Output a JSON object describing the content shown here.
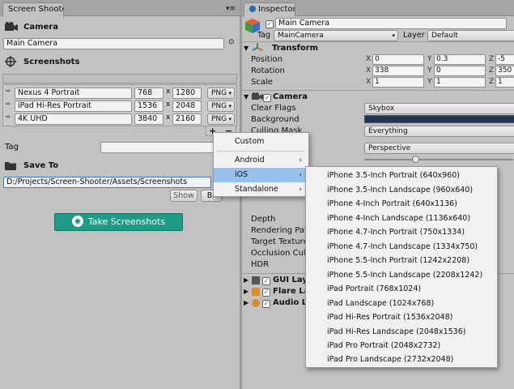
{
  "left_window": {
    "tab_title": "Screen Shooter",
    "camera_section": "Camera",
    "camera_field": "Main Camera",
    "screenshots_section": "Screenshots",
    "resolutions": [
      {
        "name": "Nexus 4 Portrait",
        "width": "768",
        "height": "1280",
        "format": "PNG"
      },
      {
        "name": "iPad Hi-Res Portrait",
        "width": "1536",
        "height": "2048",
        "format": "PNG"
      },
      {
        "name": "4K UHD",
        "width": "3840",
        "height": "2160",
        "format": "PNG"
      }
    ],
    "times": "x",
    "add_glyph": "+",
    "remove_glyph": "−",
    "tag_label": "Tag",
    "save_to_section": "Save To",
    "save_path": "D:/Projects/Screen-Shooter/Assets/Screenshots",
    "show_button": "Show",
    "browse_button": "Br",
    "take_button": "Take Screenshots"
  },
  "inspector": {
    "tab_title": "Inspector",
    "object_name": "Main Camera",
    "tag_label": "Tag",
    "tag_value": "MainCamera",
    "layer_label": "Layer",
    "layer_value": "Default",
    "transform": {
      "title": "Transform",
      "position_label": "Position",
      "rotation_label": "Rotation",
      "scale_label": "Scale",
      "axis_x": "X",
      "axis_y": "Y",
      "axis_z": "Z",
      "position": {
        "x": "0",
        "y": "0.3",
        "z": "-5"
      },
      "rotation": {
        "x": "338",
        "y": "0",
        "z": "350"
      },
      "scale": {
        "x": "1",
        "y": "1",
        "z": "1"
      }
    },
    "camera": {
      "title": "Camera",
      "clear_flags_label": "Clear Flags",
      "clear_flags_value": "Skybox",
      "background_label": "Background",
      "background_color": "#1f3557",
      "culling_mask_label": "Culling Mask",
      "culling_mask_value": "Everything",
      "projection_value": "Perspective",
      "depth_label": "Depth",
      "rendering_path_label": "Rendering Path",
      "target_texture_label": "Target Texture",
      "occlusion_label": "Occlusion Culli",
      "hdr_label": "HDR"
    },
    "components": [
      {
        "label": "GUI Lay"
      },
      {
        "label": "Flare La"
      },
      {
        "label": "Audio Li"
      }
    ]
  },
  "platform_menu": {
    "items": [
      {
        "label": "Custom",
        "has_submenu": false
      },
      {
        "label": "Android",
        "has_submenu": true
      },
      {
        "label": "iOS",
        "has_submenu": true,
        "selected": true
      },
      {
        "label": "Standalone",
        "has_submenu": true
      }
    ],
    "submenu_arrow": "›"
  },
  "ios_submenu": {
    "items": [
      "iPhone 3.5-Inch Portrait (640x960)",
      "iPhone 3.5-Inch Landscape (960x640)",
      "iPhone 4-Inch Portrait (640x1136)",
      "iPhone 4-Inch Landscape (1136x640)",
      "iPhone 4.7-Inch Portrait (750x1334)",
      "iPhone 4.7-Inch Landscape (1334x750)",
      "iPhone 5.5-Inch Portrait (1242x2208)",
      "iPhone 5.5-Inch Landscape (2208x1242)",
      "iPad Portrait (768x1024)",
      "iPad Landscape (1024x768)",
      "iPad Hi-Res Portrait (1536x2048)",
      "iPad Hi-Res Landscape (2048x1536)",
      "iPad Pro Portrait (2048x2732)",
      "iPad Pro Landscape (2732x2048)"
    ]
  },
  "colors": {
    "take_button": "#1e9c88",
    "menu_highlight": "#97c1ee"
  }
}
